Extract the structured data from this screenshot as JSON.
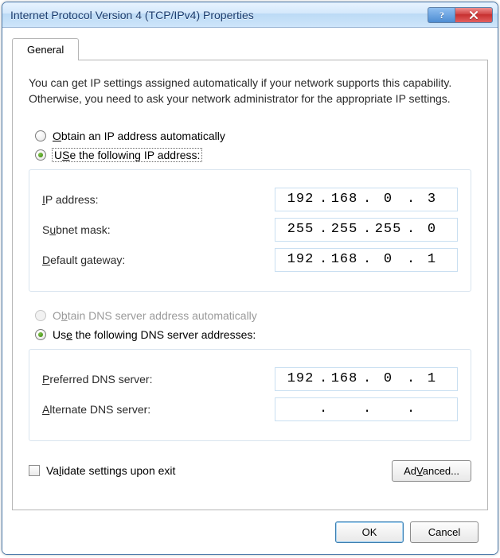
{
  "window": {
    "title": "Internet Protocol Version 4 (TCP/IPv4) Properties"
  },
  "tab": {
    "label": "General"
  },
  "description": "You can get IP settings assigned automatically if your network supports this capability. Otherwise, you need to ask your network administrator for the appropriate IP settings.",
  "ip_group": {
    "auto_label_pre": "",
    "auto_u": "O",
    "auto_label_post": "btain an IP address automatically",
    "manual_u": "S",
    "manual_label_pre": "U",
    "manual_label_post": "e the following IP address:",
    "ip_label_u": "I",
    "ip_label_post": "P address:",
    "ip": {
      "o1": "192",
      "o2": "168",
      "o3": "0",
      "o4": "3"
    },
    "subnet_u": "u",
    "subnet_pre": "S",
    "subnet_post": "bnet mask:",
    "subnet": {
      "o1": "255",
      "o2": "255",
      "o3": "255",
      "o4": "0"
    },
    "gw_u": "D",
    "gw_post": "efault gateway:",
    "gw": {
      "o1": "192",
      "o2": "168",
      "o3": "0",
      "o4": "1"
    }
  },
  "dns_group": {
    "auto_u": "b",
    "auto_pre": "O",
    "auto_post": "tain DNS server address automatically",
    "manual_u": "e",
    "manual_pre": "Us",
    "manual_post": " the following DNS server addresses:",
    "pref_u": "P",
    "pref_post": "referred DNS server:",
    "pref": {
      "o1": "192",
      "o2": "168",
      "o3": "0",
      "o4": "1"
    },
    "alt_u": "A",
    "alt_post": "lternate DNS server:",
    "alt": {
      "o1": "",
      "o2": "",
      "o3": "",
      "o4": ""
    }
  },
  "validate_u": "l",
  "validate_pre": "Va",
  "validate_post": "idate settings upon exit",
  "advanced_u": "V",
  "advanced_pre": "Ad",
  "advanced_post": "anced...",
  "ok": "OK",
  "cancel": "Cancel"
}
